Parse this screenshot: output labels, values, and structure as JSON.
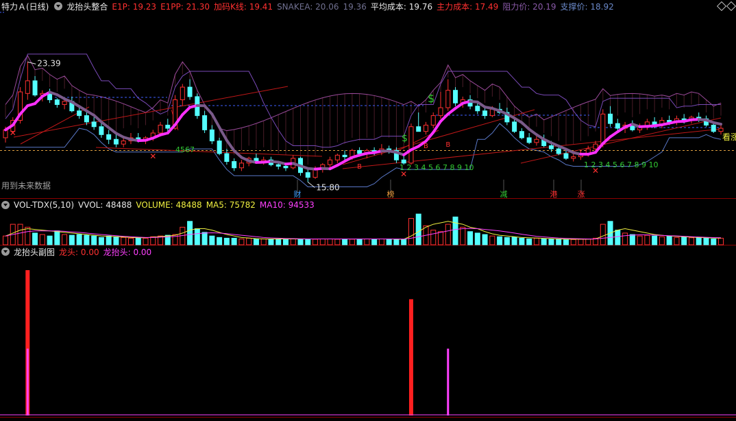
{
  "header_main": {
    "stock": "特力Ａ(日线)",
    "indicator": "龙抬头整合",
    "items": [
      {
        "label": "E1P: 19.23",
        "color": "#ff3030"
      },
      {
        "label": "E1PP: 21.30",
        "color": "#ff3030"
      },
      {
        "label": "加码K线: 19.41",
        "color": "#ff3030"
      },
      {
        "label": "SNAKEA: 20.06",
        "color": "#707090"
      },
      {
        "label": "19.36",
        "color": "#707090"
      },
      {
        "label": "平均成本: 19.76",
        "color": "#e8e8e8"
      },
      {
        "label": "主力成本: 17.49",
        "color": "#ff3030"
      },
      {
        "label": "阻力价: 20.19",
        "color": "#8a5aa8"
      },
      {
        "label": "支撑价: 18.92",
        "color": "#6a88c8"
      }
    ]
  },
  "header_vol": {
    "name": "VOL-TDX(5,10)",
    "items": [
      {
        "label": "VVOL: 48488",
        "color": "#e8e8e8"
      },
      {
        "label": "VOLUME: 48488",
        "color": "#f0f040"
      },
      {
        "label": "MA5: 75782",
        "color": "#f0f040"
      },
      {
        "label": "MA10: 94533",
        "color": "#ff40ff"
      }
    ]
  },
  "header_sub": {
    "name": "龙抬头副图",
    "items": [
      {
        "label": "龙头: 0.00",
        "color": "#ff3030"
      },
      {
        "label": "龙抬头: 0.00",
        "color": "#ff40ff"
      }
    ]
  },
  "annotations": {
    "high_price": "23.39",
    "low_price": "15.80",
    "future_data": "用到未来数据",
    "seq1": "1 2 3 4 5 6 7 8 9 10",
    "seq2": "1 2 3 4 5 6 7 8 9 10",
    "level_label": "4567",
    "bull": "看涨",
    "dollar": "$",
    "bottom_tags": [
      "财",
      "榜",
      "减",
      "港",
      "涨"
    ]
  },
  "chart_data": [
    {
      "type": "candlestick",
      "title": "龙抬头整合",
      "ohlc": [
        [
          18.6,
          19.3,
          18.3,
          19.1
        ],
        [
          19.0,
          19.9,
          18.9,
          19.7
        ],
        [
          19.7,
          21.8,
          19.5,
          21.5
        ],
        [
          21.4,
          23.39,
          21.0,
          22.2
        ],
        [
          22.2,
          22.5,
          21.2,
          21.3
        ],
        [
          21.3,
          21.6,
          20.9,
          21.4
        ],
        [
          21.4,
          21.7,
          20.8,
          21.0
        ],
        [
          21.0,
          21.1,
          20.5,
          20.7
        ],
        [
          20.7,
          21.0,
          20.4,
          20.9
        ],
        [
          20.9,
          21.2,
          20.2,
          20.3
        ],
        [
          20.3,
          20.6,
          19.8,
          20.0
        ],
        [
          20.0,
          20.3,
          19.4,
          19.6
        ],
        [
          19.6,
          19.9,
          19.1,
          19.3
        ],
        [
          19.3,
          19.6,
          18.6,
          18.8
        ],
        [
          18.8,
          19.1,
          18.2,
          18.5
        ],
        [
          18.5,
          18.8,
          18.0,
          18.2
        ],
        [
          18.2,
          18.6,
          18.0,
          18.4
        ],
        [
          18.4,
          18.9,
          18.2,
          18.6
        ],
        [
          18.6,
          18.9,
          18.3,
          18.4
        ],
        [
          18.4,
          18.7,
          18.2,
          18.6
        ],
        [
          18.6,
          19.1,
          18.4,
          18.9
        ],
        [
          18.9,
          19.6,
          18.7,
          19.4
        ],
        [
          19.4,
          19.8,
          19.0,
          19.2
        ],
        [
          19.2,
          21.3,
          19.1,
          21.0
        ],
        [
          21.0,
          22.0,
          20.6,
          21.8
        ],
        [
          21.8,
          22.3,
          21.0,
          21.2
        ],
        [
          21.2,
          21.4,
          19.8,
          20.0
        ],
        [
          20.0,
          20.3,
          18.9,
          19.1
        ],
        [
          19.1,
          19.4,
          18.2,
          18.4
        ],
        [
          18.4,
          18.6,
          17.5,
          17.6
        ],
        [
          17.6,
          17.9,
          16.9,
          17.1
        ],
        [
          17.1,
          17.3,
          16.5,
          16.7
        ],
        [
          16.7,
          17.2,
          16.5,
          17.0
        ],
        [
          17.0,
          17.4,
          16.8,
          17.3
        ],
        [
          17.3,
          17.6,
          17.0,
          17.1
        ],
        [
          17.1,
          17.4,
          16.9,
          17.2
        ],
        [
          17.2,
          17.4,
          16.8,
          16.9
        ],
        [
          16.9,
          17.1,
          16.6,
          16.8
        ],
        [
          16.8,
          17.0,
          16.5,
          16.7
        ],
        [
          16.7,
          17.5,
          16.6,
          17.3
        ],
        [
          17.3,
          17.4,
          16.2,
          16.4
        ],
        [
          16.4,
          16.6,
          15.8,
          16.1
        ],
        [
          16.1,
          16.8,
          16.0,
          16.6
        ],
        [
          16.6,
          17.0,
          16.4,
          16.9
        ],
        [
          16.9,
          17.4,
          16.7,
          17.2
        ],
        [
          17.2,
          17.6,
          17.0,
          17.5
        ],
        [
          17.5,
          17.8,
          17.2,
          17.4
        ],
        [
          17.4,
          17.9,
          17.2,
          17.8
        ],
        [
          17.8,
          18.0,
          17.4,
          17.6
        ],
        [
          17.6,
          17.9,
          17.3,
          17.8
        ],
        [
          17.8,
          18.0,
          17.5,
          17.7
        ],
        [
          17.7,
          18.2,
          17.5,
          17.9
        ],
        [
          17.9,
          18.1,
          17.6,
          17.8
        ],
        [
          17.8,
          18.0,
          17.0,
          17.2
        ],
        [
          17.2,
          17.5,
          16.9,
          17.0
        ],
        [
          17.0,
          19.5,
          16.9,
          19.3
        ],
        [
          19.3,
          20.2,
          19.0,
          19.0
        ],
        [
          19.0,
          19.6,
          18.8,
          19.4
        ],
        [
          19.4,
          20.2,
          19.2,
          20.0
        ],
        [
          20.0,
          21.5,
          19.8,
          20.5
        ],
        [
          20.5,
          22.3,
          20.3,
          21.6
        ],
        [
          21.6,
          21.8,
          20.6,
          20.8
        ],
        [
          20.8,
          21.2,
          20.5,
          21.0
        ],
        [
          21.0,
          21.3,
          20.4,
          20.6
        ],
        [
          20.6,
          20.9,
          20.1,
          20.3
        ],
        [
          20.3,
          20.6,
          19.8,
          20.0
        ],
        [
          20.0,
          20.6,
          19.9,
          20.4
        ],
        [
          20.4,
          20.8,
          20.1,
          20.2
        ],
        [
          20.2,
          20.5,
          19.4,
          19.6
        ],
        [
          19.6,
          19.8,
          18.9,
          19.0
        ],
        [
          19.0,
          19.2,
          18.5,
          18.6
        ],
        [
          18.6,
          18.9,
          18.2,
          18.3
        ],
        [
          18.3,
          18.7,
          18.1,
          18.5
        ],
        [
          18.5,
          18.8,
          18.0,
          18.1
        ],
        [
          18.1,
          18.4,
          17.7,
          17.9
        ],
        [
          17.9,
          18.1,
          17.5,
          17.6
        ],
        [
          17.6,
          17.8,
          17.2,
          17.3
        ],
        [
          17.3,
          17.6,
          17.1,
          17.4
        ],
        [
          17.4,
          17.8,
          17.2,
          17.6
        ],
        [
          17.6,
          18.1,
          17.4,
          17.9
        ],
        [
          17.9,
          18.4,
          17.7,
          18.2
        ],
        [
          18.2,
          20.4,
          18.0,
          20.1
        ],
        [
          20.1,
          20.6,
          19.3,
          19.5
        ],
        [
          19.5,
          19.8,
          19.0,
          19.2
        ],
        [
          19.2,
          19.6,
          18.9,
          19.4
        ],
        [
          19.4,
          19.7,
          19.0,
          19.1
        ],
        [
          19.1,
          19.5,
          18.9,
          19.3
        ],
        [
          19.3,
          19.8,
          19.1,
          19.6
        ],
        [
          19.6,
          19.9,
          19.2,
          19.4
        ],
        [
          19.4,
          19.9,
          19.2,
          19.7
        ],
        [
          19.7,
          20.0,
          19.4,
          19.6
        ],
        [
          19.6,
          20.0,
          19.4,
          19.8
        ],
        [
          19.8,
          20.1,
          19.5,
          19.7
        ],
        [
          19.7,
          20.0,
          19.5,
          19.9
        ],
        [
          19.9,
          20.2,
          19.6,
          19.8
        ],
        [
          19.8,
          20.0,
          19.3,
          19.4
        ],
        [
          19.4,
          19.6,
          18.9,
          19.0
        ],
        [
          19.0,
          19.4,
          18.8,
          19.2
        ]
      ]
    },
    {
      "type": "bar",
      "title": "VOL-TDX(5,10)",
      "values": [
        60,
        140,
        140,
        120,
        80,
        70,
        60,
        95,
        70,
        65,
        70,
        65,
        60,
        50,
        60,
        55,
        50,
        45,
        50,
        45,
        55,
        60,
        65,
        70,
        120,
        160,
        110,
        85,
        60,
        50,
        45,
        45,
        40,
        45,
        40,
        40,
        38,
        40,
        38,
        40,
        40,
        40,
        38,
        40,
        40,
        38,
        40,
        38,
        40,
        40,
        38,
        40,
        40,
        35,
        36,
        180,
        210,
        130,
        100,
        90,
        140,
        190,
        120,
        90,
        80,
        70,
        60,
        55,
        50,
        52,
        45,
        40,
        45,
        40,
        38,
        40,
        35,
        36,
        38,
        40,
        45,
        140,
        160,
        100,
        80,
        70,
        60,
        65,
        60,
        55,
        60,
        50,
        52,
        48,
        50,
        45,
        40,
        45
      ],
      "ma5": [
        60,
        80,
        100,
        110,
        105,
        100,
        95,
        90,
        85,
        80,
        75,
        70,
        65,
        60,
        58,
        55,
        53,
        50,
        48,
        48,
        52,
        56,
        60,
        65,
        80,
        100,
        110,
        110,
        100,
        85,
        70,
        60,
        50,
        46,
        42,
        40,
        40,
        40,
        40,
        40,
        40,
        40,
        40,
        40,
        40,
        40,
        40,
        40,
        40,
        40,
        40,
        40,
        40,
        38,
        38,
        60,
        90,
        120,
        140,
        150,
        160,
        150,
        140,
        120,
        110,
        90,
        75,
        65,
        60,
        55,
        50,
        48,
        46,
        44,
        42,
        40,
        38,
        38,
        38,
        38,
        40,
        60,
        80,
        100,
        110,
        100,
        90,
        80,
        70,
        65,
        60,
        58,
        55,
        52,
        50,
        48,
        46,
        45
      ],
      "ma10": [
        60,
        70,
        80,
        90,
        95,
        95,
        95,
        95,
        92,
        88,
        85,
        80,
        75,
        70,
        66,
        62,
        58,
        55,
        52,
        50,
        50,
        52,
        54,
        57,
        63,
        70,
        76,
        80,
        82,
        80,
        76,
        70,
        65,
        60,
        55,
        50,
        47,
        45,
        43,
        42,
        41,
        40,
        40,
        40,
        40,
        40,
        40,
        40,
        40,
        40,
        40,
        40,
        40,
        40,
        39,
        45,
        55,
        65,
        75,
        85,
        95,
        105,
        110,
        112,
        110,
        105,
        100,
        95,
        88,
        80,
        72,
        65,
        58,
        54,
        50,
        46,
        44,
        42,
        41,
        40,
        40,
        45,
        50,
        56,
        62,
        66,
        68,
        68,
        66,
        64,
        62,
        60,
        58,
        55,
        53,
        51,
        49,
        48
      ]
    },
    {
      "type": "bar",
      "title": "龙抬头副图",
      "series": [
        {
          "name": "龙头",
          "values": [
            {
              "x": 3,
              "y": 1.0
            },
            {
              "x": 55,
              "y": 0.8
            }
          ]
        },
        {
          "name": "龙抬头",
          "values": [
            {
              "x": 3,
              "y": 0.46
            },
            {
              "x": 60,
              "y": 0.46
            }
          ]
        }
      ]
    }
  ]
}
